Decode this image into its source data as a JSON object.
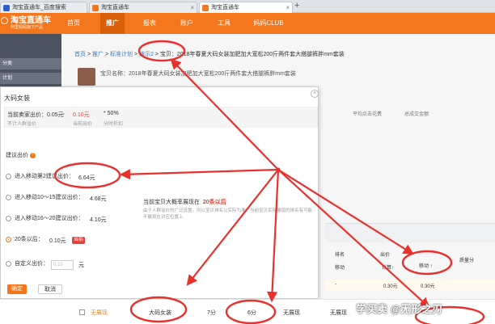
{
  "browser_tabs": [
    {
      "label": "淘宝直通车_百度搜索"
    },
    {
      "label": "淘宝直通车"
    },
    {
      "label": "淘宝直通车"
    }
  ],
  "brand": {
    "title": "淘宝直通车",
    "subtitle": "阿里妈妈旗下产品"
  },
  "nav": {
    "items": [
      "首页",
      "推广",
      "报表",
      "账户",
      "工具",
      "妈妈CLUB"
    ],
    "active_index": 1
  },
  "sidebar": {
    "labels": [
      "分类",
      "计划",
      "推广"
    ]
  },
  "breadcrumb": {
    "home": "首页",
    "sep": ">",
    "promo": "推广",
    "plan": "标准计划",
    "unit": "演示2",
    "item": "宝贝：2018年春夏大码女装加肥加大宽松200斤两件套大搭腿裤胖mm套装"
  },
  "product": {
    "name": "宝贝名称：2018年春夏大码女装加肥加大宽松200斤两件套大搭腿裤胖mm套装",
    "stats_labels": [
      "平均点击花费",
      "总成交金额"
    ]
  },
  "modal": {
    "keyword": "大码女装",
    "current_bid_label": "当前卖家出价：0.05元",
    "arrow": "→",
    "new_bid": "0.10元",
    "ratio": "* 50%",
    "note_no_crowd": "不计人群溢价",
    "note_current": "当前出价",
    "note_time": "分时折扣",
    "suggest_label": "建议出价",
    "info_icon": "?",
    "options": [
      {
        "label": "进入移动第2建议出价：",
        "price": "6.64元"
      },
      {
        "label": "进入移动10～15建议出价：",
        "price": "4.68元"
      },
      {
        "label": "进入移动16～20建议出价：",
        "price": "4.10元"
      },
      {
        "label": "20条以后：",
        "price": "0.10元",
        "badge": "当前"
      }
    ],
    "custom_label": "自定义出价：",
    "custom_placeholder": "0.10",
    "custom_unit": "元",
    "exposure_prefix": "当前宝贝大概率展现在",
    "exposure_value": "20条以后",
    "exposure_note": "由于人群溢价的广泛设置，所以宝贝排名以实际为准。当前宝贝实际展现的排名有可能不展现在对应位置上",
    "ok_label": "确定",
    "cancel_label": "取消",
    "close_icon": "×"
  },
  "table": {
    "col_rank": "排名",
    "col_bid": "出价",
    "sub_device": "移动",
    "sub_calc": "计算↑",
    "sub_mobile": "移动 ↑",
    "col_quality": "质量分",
    "row_rank": "-",
    "row_bid": "0.30元",
    "row_mobile": "0.30元"
  },
  "bottom": {
    "status": "无展现",
    "keyword": "大码女装",
    "score_pc": "7分",
    "score_mobile": "6分",
    "display_1": "无展现",
    "display_2": "无展现"
  },
  "watermark": "学买卖 @无形之刃",
  "colors": {
    "brand": "#f4771d",
    "highlight": "#e0443b",
    "annotation": "#e8302c",
    "link": "#3d7cc9"
  }
}
